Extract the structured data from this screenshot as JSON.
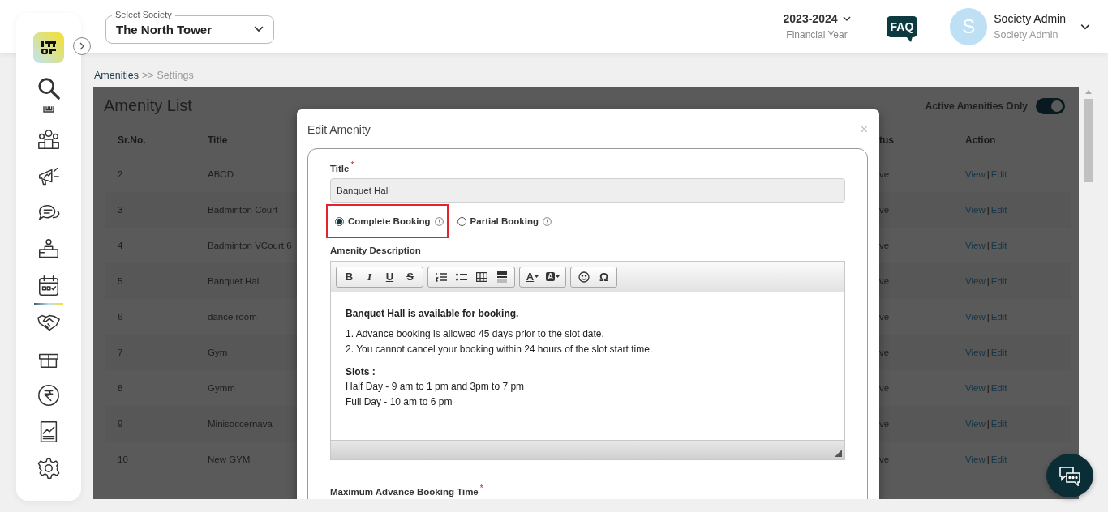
{
  "sidebar": {
    "items": [
      {
        "kind": "search",
        "selected": false
      },
      {
        "kind": "building",
        "selected": false
      },
      {
        "kind": "people",
        "selected": false
      },
      {
        "kind": "megaphone",
        "selected": false
      },
      {
        "kind": "chat",
        "selected": false
      },
      {
        "kind": "desk",
        "selected": false
      },
      {
        "kind": "calendar",
        "selected": true
      },
      {
        "kind": "handshake",
        "selected": false
      },
      {
        "kind": "box",
        "selected": false
      },
      {
        "kind": "rupee",
        "selected": false
      },
      {
        "kind": "report",
        "selected": false
      },
      {
        "kind": "settings",
        "selected": false
      }
    ]
  },
  "header": {
    "society_select": {
      "label": "Select Society",
      "value": "The North Tower"
    },
    "year": {
      "value": "2023-2024",
      "caption": "Financial Year"
    },
    "faq": "FAQ",
    "user": {
      "initial": "S",
      "name": "Society Admin",
      "role": "Society Admin"
    }
  },
  "breadcrumb": {
    "parent": "Amenities",
    "separator": ">>",
    "current": "Settings"
  },
  "amenity_list": {
    "title": "Amenity List",
    "filter": {
      "label": "Active Amenities Only",
      "on": true
    },
    "columns": [
      "Sr.No.",
      "Title",
      "tus",
      "Action"
    ],
    "rows": [
      {
        "sr": "2",
        "title": "ABCD",
        "status": "ve",
        "view": "View",
        "separator": "|",
        "edit": "Edit"
      },
      {
        "sr": "3",
        "title": "Badminton Court",
        "status": "ve",
        "view": "View",
        "separator": "|",
        "edit": "Edit"
      },
      {
        "sr": "4",
        "title": "Badminton VCourt 6",
        "status": "ve",
        "view": "View",
        "separator": "|",
        "edit": "Edit"
      },
      {
        "sr": "5",
        "title": "Banquet Hall",
        "status": "ve",
        "view": "View",
        "separator": "|",
        "edit": "Edit"
      },
      {
        "sr": "6",
        "title": "dance room",
        "status": "ve",
        "view": "View",
        "separator": "|",
        "edit": "Edit"
      },
      {
        "sr": "7",
        "title": "Gym",
        "status": "ve",
        "view": "View",
        "separator": "|",
        "edit": "Edit"
      },
      {
        "sr": "8",
        "title": "Gymm",
        "status": "ve",
        "view": "View",
        "separator": "|",
        "edit": "Edit"
      },
      {
        "sr": "9",
        "title": "Minisoccernava",
        "status": "ve",
        "view": "View",
        "separator": "|",
        "edit": "Edit"
      },
      {
        "sr": "10",
        "title": "New GYM",
        "status": "ve",
        "view": "View",
        "separator": "|",
        "edit": "Edit"
      }
    ]
  },
  "modal": {
    "title": "Edit Amenity",
    "close": "×",
    "title_field": {
      "label": "Title",
      "required_mark": "*",
      "value": "Banquet Hall"
    },
    "booking_types": [
      {
        "label": "Complete Booking",
        "selected": true,
        "highlighted": true
      },
      {
        "label": "Partial Booking",
        "selected": false,
        "highlighted": false
      }
    ],
    "description": {
      "label": "Amenity Description",
      "toolbar": [
        [
          {
            "kind": "bold",
            "label": "B"
          },
          {
            "kind": "italic",
            "label": "I"
          },
          {
            "kind": "underline",
            "label": "U"
          },
          {
            "kind": "strike",
            "label": "S"
          }
        ],
        [
          {
            "kind": "ordered"
          },
          {
            "kind": "bullets"
          },
          {
            "kind": "table"
          },
          {
            "kind": "rule"
          }
        ],
        [
          {
            "kind": "textcolor",
            "label": "A"
          },
          {
            "kind": "bgcolor",
            "label": "A"
          }
        ],
        [
          {
            "kind": "emoji"
          },
          {
            "kind": "symbol",
            "label": "Ω"
          }
        ]
      ],
      "heading": "Banquet Hall is available for booking.",
      "rules": [
        "1. Advance booking is allowed 45 days prior to the slot date.",
        "2. You cannot cancel your booking within 24 hours of the slot start time."
      ],
      "slots_label": "Slots :",
      "slots": [
        "Half Day - 9 am to 1 pm and 3pm to 7 pm",
        "Full Day - 10 am to 6 pm"
      ]
    },
    "max_advance": {
      "label": "Maximum Advance Booking Time",
      "required_mark": "*"
    }
  }
}
